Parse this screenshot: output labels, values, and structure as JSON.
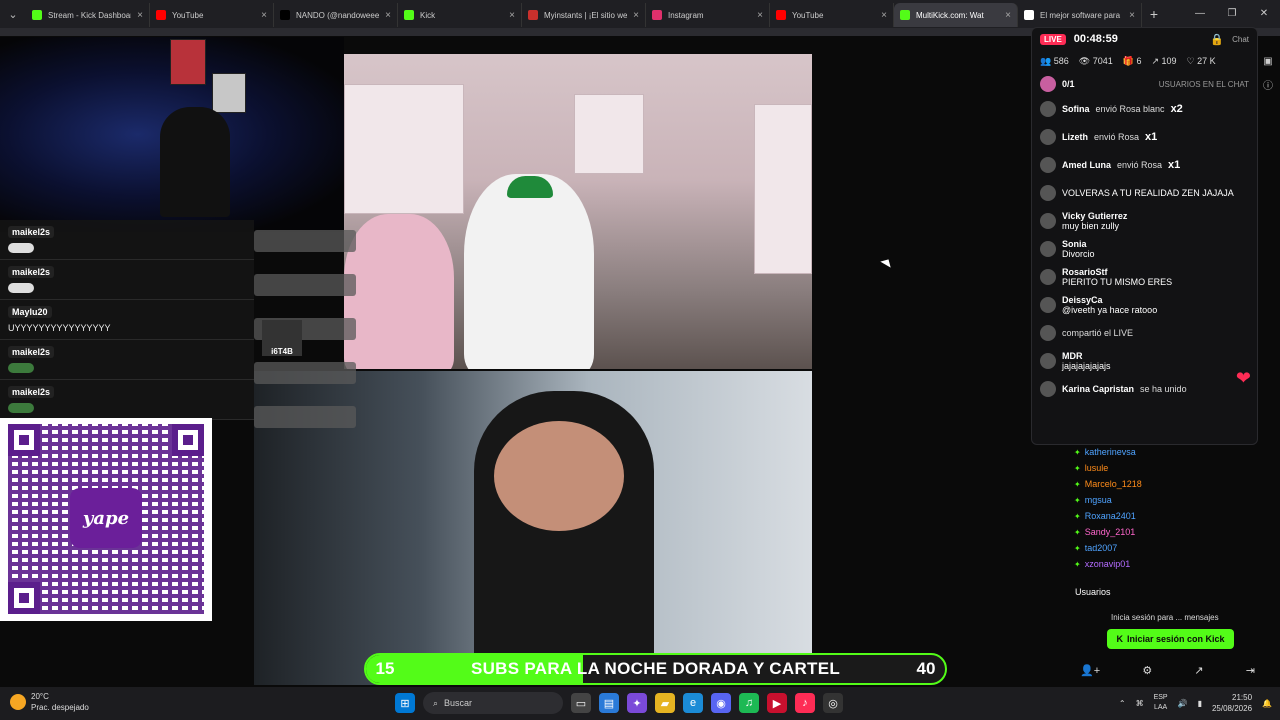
{
  "browser": {
    "tabs": [
      {
        "title": "Stream - Kick Dashboard",
        "color": "#53fc18"
      },
      {
        "title": "YouTube",
        "color": "#ff0000"
      },
      {
        "title": "NANDO (@nandoweee)",
        "color": "#000000"
      },
      {
        "title": "Kick",
        "color": "#53fc18"
      },
      {
        "title": "Myinstants | ¡El sitio web",
        "color": "#c9302c"
      },
      {
        "title": "Instagram",
        "color": "#e1306c"
      },
      {
        "title": "YouTube",
        "color": "#ff0000"
      },
      {
        "title": "MultiKick.com: Wat",
        "color": "#53fc18",
        "active": true
      },
      {
        "title": "El mejor software para",
        "color": "#ffffff"
      }
    ]
  },
  "stream_chat": [
    {
      "user": "maikel2s",
      "type": "emote"
    },
    {
      "user": "maikel2s",
      "type": "emote"
    },
    {
      "user": "Maylu20",
      "text": "UYYYYYYYYYYYYYYYY"
    },
    {
      "user": "maikel2s",
      "type": "emote-green"
    },
    {
      "user": "maikel2s",
      "type": "emote-green"
    }
  ],
  "qr": {
    "brand": "yape"
  },
  "webcam_label": "i6T4B",
  "goal": {
    "current": "15",
    "target": "40",
    "label": "SUBS PARA LA NOCHE DORADA Y CARTEL",
    "progress": 0.375
  },
  "tiktok": {
    "live_label": "LIVE",
    "timer": "00:48:59",
    "chat_label": "Chat",
    "stats": {
      "viewers": "586",
      "views": "7041",
      "gifts": "6",
      "shares": "109",
      "likes": "27 K"
    },
    "counter": "0/1",
    "users_in_chat": "USUARIOS EN EL CHAT",
    "rows": [
      {
        "name": "Sofina",
        "action": "envió Rosa blanc",
        "mult": "x2"
      },
      {
        "name": "Lizeth",
        "action": "envió Rosa",
        "mult": "x1"
      },
      {
        "name": "Amed Luna",
        "action": "envió Rosa",
        "mult": "x1"
      },
      {
        "name": "",
        "message": "VOLVERAS A TU REALIDAD ZEN JAJAJA"
      },
      {
        "name": "Vicky Gutierrez",
        "message": "muy bien zully"
      },
      {
        "name": "Sonia",
        "message": "Divorcio"
      },
      {
        "name": "RosarioStf",
        "message": "PIERITO TU MISMO ERES"
      },
      {
        "name": "DeissyCa",
        "message": "@iveeth ya hace ratooo"
      },
      {
        "name": "",
        "action": "compartió el LIVE"
      },
      {
        "name": "MDR",
        "message": "jajajajajajajs"
      },
      {
        "name": "Karina Capristan",
        "action": "se ha unido"
      }
    ]
  },
  "users": [
    {
      "name": "katherinevsa",
      "color": "#4fa3ff"
    },
    {
      "name": "lusule",
      "color": "#ff8c1a"
    },
    {
      "name": "Marcelo_1218",
      "color": "#ff8c1a"
    },
    {
      "name": "mgsua",
      "color": "#4fa3ff"
    },
    {
      "name": "Roxana2401",
      "color": "#4fa3ff"
    },
    {
      "name": "Sandy_2101",
      "color": "#ff66cc"
    },
    {
      "name": "tad2007",
      "color": "#4fa3ff"
    },
    {
      "name": "xzonavip01",
      "color": "#b36bff"
    }
  ],
  "users_label": "Usuarios",
  "login_hint": "Inicia sesión para ... mensajes",
  "login_button": "Iniciar sesión con Kick",
  "taskbar": {
    "temp": "20°C",
    "weather": "Prac. despejado",
    "search": "Buscar",
    "lang1": "ESP",
    "lang2": "LAA",
    "time": "21:50",
    "date": "25/08/2026"
  }
}
